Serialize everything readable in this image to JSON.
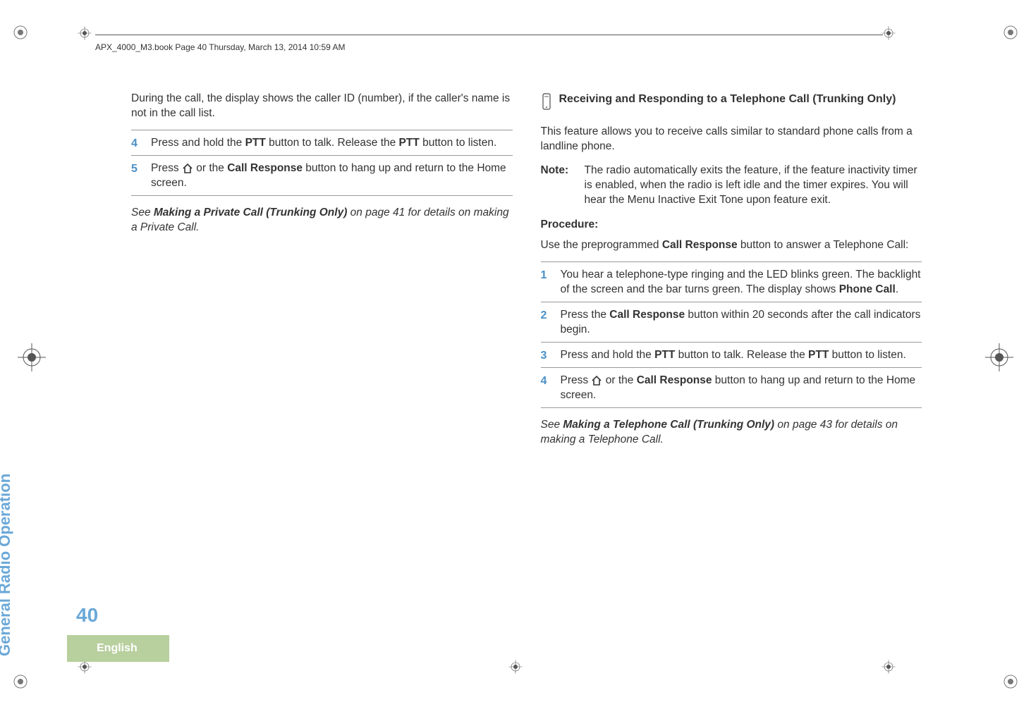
{
  "header": {
    "runningHead": "APX_4000_M3.book  Page 40  Thursday, March 13, 2014  10:59 AM"
  },
  "sidebar": {
    "sectionTitle": "General Radio Operation",
    "pageNumber": "40",
    "language": "English"
  },
  "leftColumn": {
    "continuation": "During the call, the display shows the caller ID (number), if the caller's name is not in the call list.",
    "step4": {
      "num": "4",
      "prefix": "Press and hold the ",
      "ptt1": "PTT",
      "mid": " button to talk. Release the ",
      "ptt2": "PTT",
      "suffix": " button to listen."
    },
    "step5": {
      "num": "5",
      "prefix": "Press ",
      "mid": " or the ",
      "callResp": "Call Response",
      "suffix": " button to hang up and return to the Home screen."
    },
    "seeNote": {
      "prefix": "See ",
      "link": "Making a Private Call (Trunking Only)",
      "suffix": " on page 41 for details on making a Private Call."
    }
  },
  "rightColumn": {
    "heading": "Receiving and Responding to a Telephone Call (Trunking Only)",
    "intro": "This feature allows you to receive calls similar to standard phone calls from a landline phone.",
    "note": {
      "label": "Note:",
      "text": "The radio automatically exits the feature, if the feature inactivity timer is enabled, when the radio is left idle and the timer expires. You will hear the Menu Inactive Exit Tone upon feature exit."
    },
    "procedureLabel": "Procedure:",
    "procedureIntro": {
      "prefix": "Use the preprogrammed ",
      "callResp": "Call Response",
      "suffix": " button to answer a Telephone Call:"
    },
    "step1": {
      "num": "1",
      "prefix": "You hear a telephone-type ringing and the LED blinks green. The backlight of the screen and the bar turns green. The display shows ",
      "display": "Phone Call",
      "suffix": "."
    },
    "step2": {
      "num": "2",
      "prefix": "Press the ",
      "callResp": "Call Response",
      "suffix": " button within 20 seconds after the call indicators begin."
    },
    "step3": {
      "num": "3",
      "prefix": "Press and hold the ",
      "ptt1": "PTT",
      "mid": " button to talk. Release the ",
      "ptt2": "PTT",
      "suffix": " button to listen."
    },
    "step4": {
      "num": "4",
      "prefix": "Press ",
      "mid": " or the ",
      "callResp": "Call Response",
      "suffix": " button to hang up and return to the Home screen."
    },
    "seeNote": {
      "prefix": "See ",
      "link": "Making a Telephone Call (Trunking Only)",
      "suffix": " on page 43 for details on making a Telephone Call."
    }
  }
}
